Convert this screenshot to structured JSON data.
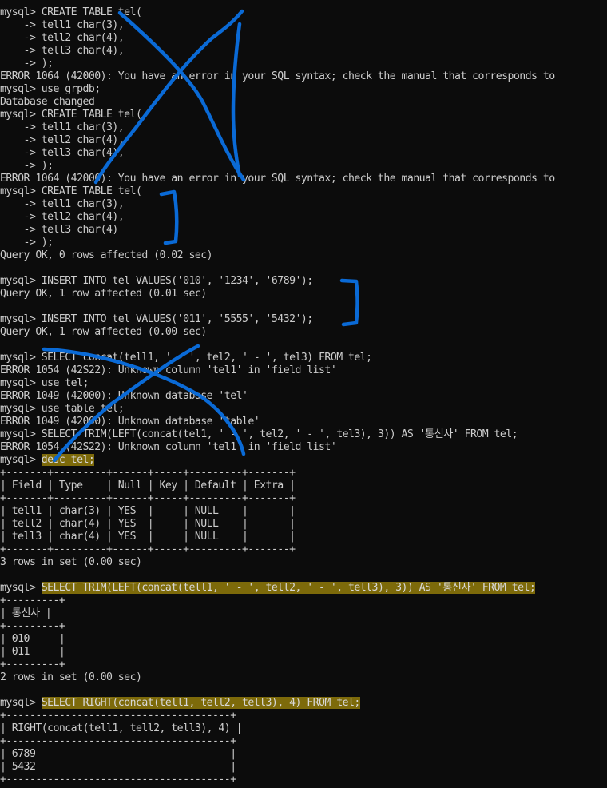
{
  "window": {
    "background": "#0c0c0c",
    "text_color": "#cccccc",
    "highlight_color": "#7d6a0a",
    "annotation_color": "#0a6ad6"
  },
  "lines": [
    {
      "text": "mysql> CREATE TABLE tel("
    },
    {
      "text": "    -> tell1 char(3),"
    },
    {
      "text": "    -> tell2 char(4),"
    },
    {
      "text": "    -> tell3 char(4),"
    },
    {
      "text": "    -> );"
    },
    {
      "text": "ERROR 1064 (42000): You have an error in your SQL syntax; check the manual that corresponds to"
    },
    {
      "text": "mysql> use grpdb;"
    },
    {
      "text": "Database changed"
    },
    {
      "text": "mysql> CREATE TABLE tel("
    },
    {
      "text": "    -> tell1 char(3),"
    },
    {
      "text": "    -> tell2 char(4),"
    },
    {
      "text": "    -> tell3 char(4),"
    },
    {
      "text": "    -> );"
    },
    {
      "text": "ERROR 1064 (42000): You have an error in your SQL syntax; check the manual that corresponds to"
    },
    {
      "text": "mysql> CREATE TABLE tel("
    },
    {
      "text": "    -> tell1 char(3),"
    },
    {
      "text": "    -> tell2 char(4),"
    },
    {
      "text": "    -> tell3 char(4)"
    },
    {
      "text": "    -> );"
    },
    {
      "text": "Query OK, 0 rows affected (0.02 sec)"
    },
    {
      "text": ""
    },
    {
      "text": "mysql> INSERT INTO tel VALUES('010', '1234', '6789');"
    },
    {
      "text": "Query OK, 1 row affected (0.01 sec)"
    },
    {
      "text": ""
    },
    {
      "text": "mysql> INSERT INTO tel VALUES('011', '5555', '5432');"
    },
    {
      "text": "Query OK, 1 row affected (0.00 sec)"
    },
    {
      "text": ""
    },
    {
      "text": "mysql> SELECT concat(tell1, ' - ', tel2, ' - ', tel3) FROM tel;"
    },
    {
      "text": "ERROR 1054 (42S22): Unknown column 'tel1' in 'field list'"
    },
    {
      "text": "mysql> use tel;"
    },
    {
      "text": "ERROR 1049 (42000): Unknown database 'tel'"
    },
    {
      "text": "mysql> use table tel;"
    },
    {
      "text": "ERROR 1049 (42000): Unknown database 'table'"
    },
    {
      "text": "mysql> SELECT TRIM(LEFT(concat(tel1, ' - ', tel2, ' - ', tel3), 3)) AS '통신사' FROM tel;"
    },
    {
      "text": "ERROR 1054 (42S22): Unknown column 'tel1' in 'field list'"
    },
    {
      "prompt": "mysql> ",
      "command": "desc tel;"
    },
    {
      "text": "+-------+---------+------+-----+---------+-------+"
    },
    {
      "text": "| Field | Type    | Null | Key | Default | Extra |"
    },
    {
      "text": "+-------+---------+------+-----+---------+-------+"
    },
    {
      "text": "| tell1 | char(3) | YES  |     | NULL    |       |"
    },
    {
      "text": "| tell2 | char(4) | YES  |     | NULL    |       |"
    },
    {
      "text": "| tell3 | char(4) | YES  |     | NULL    |       |"
    },
    {
      "text": "+-------+---------+------+-----+---------+-------+"
    },
    {
      "text": "3 rows in set (0.00 sec)"
    },
    {
      "text": ""
    },
    {
      "prompt": "mysql> ",
      "command": "SELECT TRIM(LEFT(concat(tell1, ' - ', tell2, ' - ', tell3), 3)) AS '통신사' FROM tel;"
    },
    {
      "text": "+---------+"
    },
    {
      "text": "| 통신사 |"
    },
    {
      "text": "+---------+"
    },
    {
      "text": "| 010     |"
    },
    {
      "text": "| 011     |"
    },
    {
      "text": "+---------+"
    },
    {
      "text": "2 rows in set (0.00 sec)"
    },
    {
      "text": ""
    },
    {
      "prompt": "mysql> ",
      "command": "SELECT RIGHT(concat(tell1, tell2, tell3), 4) FROM tel;"
    },
    {
      "text": "+--------------------------------------+"
    },
    {
      "text": "| RIGHT(concat(tell1, tell2, tell3), 4) |"
    },
    {
      "text": "+--------------------------------------+"
    },
    {
      "text": "| 6789                                 |"
    },
    {
      "text": "| 5432                                 |"
    },
    {
      "text": "+--------------------------------------+"
    }
  ]
}
